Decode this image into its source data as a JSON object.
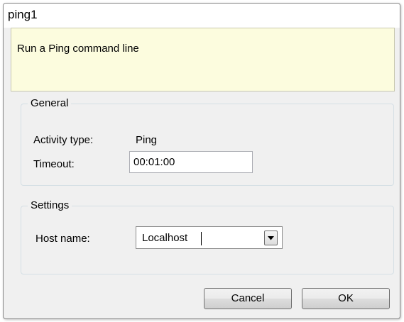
{
  "window": {
    "title": "ping1"
  },
  "description": {
    "text": "Run a Ping command line"
  },
  "general": {
    "legend": "General",
    "activity_type_label": "Activity type:",
    "activity_type_value": "Ping",
    "timeout_label": "Timeout:",
    "timeout_value": "00:01:00"
  },
  "settings": {
    "legend": "Settings",
    "host_name_label": "Host name:",
    "host_name_value": "Localhost",
    "host_name_dropdown_icon": "chevron-down-icon"
  },
  "buttons": {
    "cancel_label": "Cancel",
    "ok_label": "OK"
  },
  "colors": {
    "description_background": "#fcfcde",
    "dialog_background": "#f0f0f0"
  }
}
